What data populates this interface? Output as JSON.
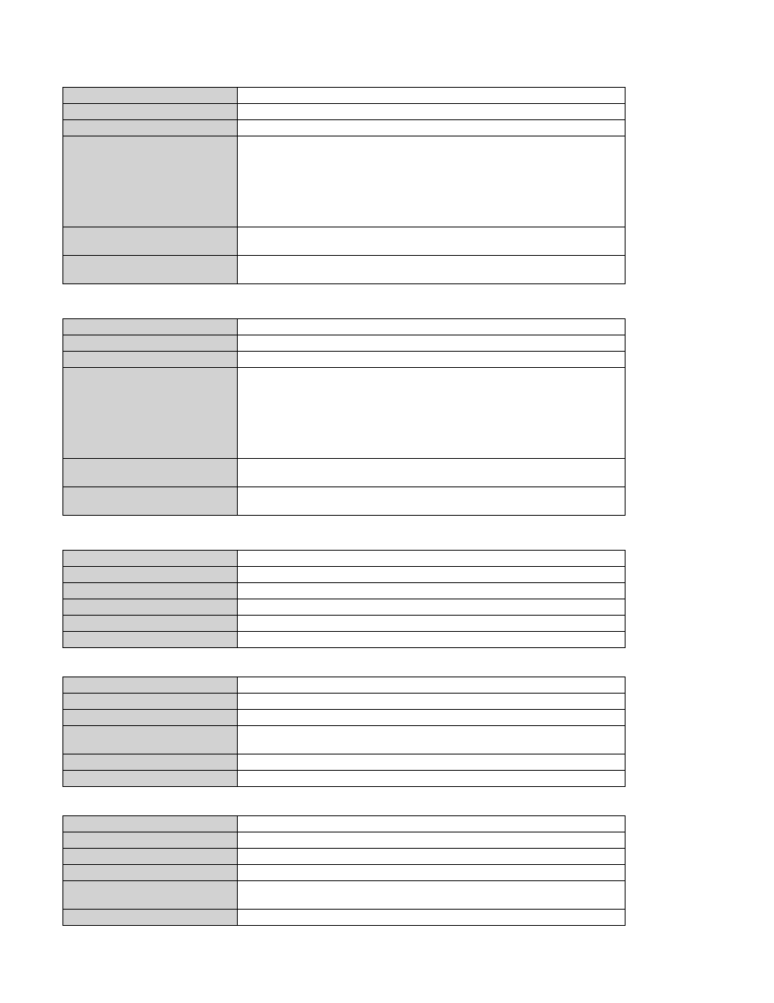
{
  "tables": [
    {
      "rows": [
        {
          "label": "",
          "value": "",
          "labelHeight": 20,
          "valueHeight": 20
        },
        {
          "label": "",
          "value": "",
          "labelHeight": 20,
          "valueHeight": 20
        },
        {
          "label": "",
          "value": "",
          "labelHeight": 20,
          "valueHeight": 20
        },
        {
          "label": "",
          "value": "",
          "labelHeight": 112,
          "valueHeight": 112
        },
        {
          "label": "",
          "value": "",
          "labelHeight": 35,
          "valueHeight": 35
        },
        {
          "label": "",
          "value": "",
          "labelHeight": 35,
          "valueHeight": 35
        }
      ]
    },
    {
      "rows": [
        {
          "label": "",
          "value": "",
          "labelHeight": 20,
          "valueHeight": 20
        },
        {
          "label": "",
          "value": "",
          "labelHeight": 20,
          "valueHeight": 20
        },
        {
          "label": "",
          "value": "",
          "labelHeight": 20,
          "valueHeight": 20
        },
        {
          "label": "",
          "value": "",
          "labelHeight": 112,
          "valueHeight": 112
        },
        {
          "label": "",
          "value": "",
          "labelHeight": 35,
          "valueHeight": 35
        },
        {
          "label": "",
          "value": "",
          "labelHeight": 35,
          "valueHeight": 35
        }
      ]
    },
    {
      "rows": [
        {
          "label": "",
          "value": "",
          "labelHeight": 20,
          "valueHeight": 20
        },
        {
          "label": "",
          "value": "",
          "labelHeight": 20,
          "valueHeight": 20
        },
        {
          "label": "",
          "value": "",
          "labelHeight": 20,
          "valueHeight": 20
        },
        {
          "label": "",
          "value": "",
          "labelHeight": 20,
          "valueHeight": 20
        },
        {
          "label": "",
          "value": "",
          "labelHeight": 20,
          "valueHeight": 20
        },
        {
          "label": "",
          "value": "",
          "labelHeight": 20,
          "valueHeight": 20
        }
      ]
    },
    {
      "rows": [
        {
          "label": "",
          "value": "",
          "labelHeight": 20,
          "valueHeight": 20
        },
        {
          "label": "",
          "value": "",
          "labelHeight": 20,
          "valueHeight": 20
        },
        {
          "label": "",
          "value": "",
          "labelHeight": 20,
          "valueHeight": 20
        },
        {
          "label": "",
          "value": "",
          "labelHeight": 35,
          "valueHeight": 35
        },
        {
          "label": "",
          "value": "",
          "labelHeight": 20,
          "valueHeight": 20
        },
        {
          "label": "",
          "value": "",
          "labelHeight": 20,
          "valueHeight": 20
        }
      ]
    },
    {
      "rows": [
        {
          "label": "",
          "value": "",
          "labelHeight": 20,
          "valueHeight": 20
        },
        {
          "label": "",
          "value": "",
          "labelHeight": 20,
          "valueHeight": 20
        },
        {
          "label": "",
          "value": "",
          "labelHeight": 20,
          "valueHeight": 20
        },
        {
          "label": "",
          "value": "",
          "labelHeight": 20,
          "valueHeight": 20
        },
        {
          "label": "",
          "value": "",
          "labelHeight": 35,
          "valueHeight": 35
        },
        {
          "label": "",
          "value": "",
          "labelHeight": 20,
          "valueHeight": 20
        }
      ]
    }
  ]
}
